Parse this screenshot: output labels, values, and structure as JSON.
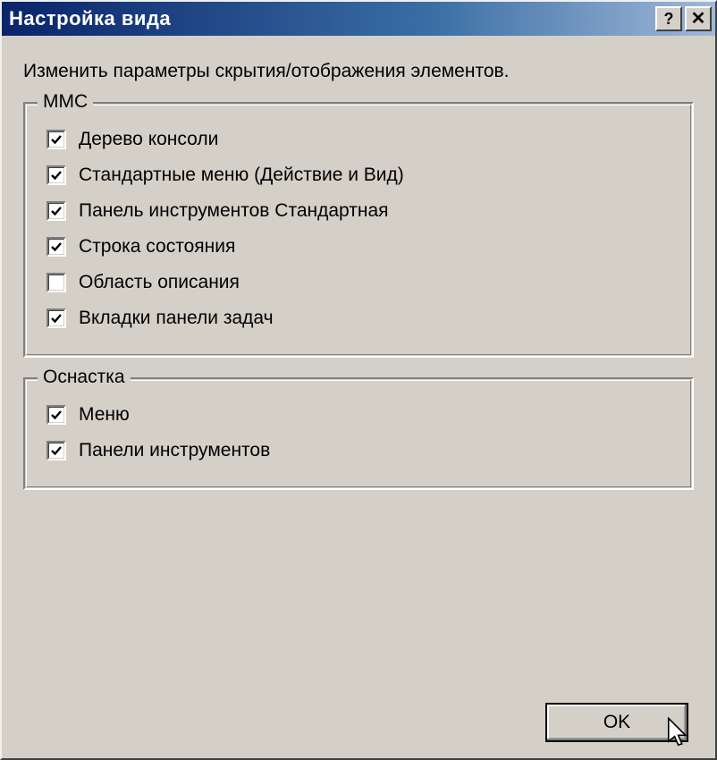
{
  "window": {
    "title": "Настройка вида"
  },
  "instruction": "Изменить параметры скрытия/отображения элементов.",
  "groups": {
    "mmc": {
      "legend": "MMC",
      "items": [
        {
          "label": "Дерево консоли",
          "checked": true
        },
        {
          "label": "Стандартные меню (Действие и Вид)",
          "checked": true
        },
        {
          "label": "Панель инструментов Стандартная",
          "checked": true
        },
        {
          "label": "Строка состояния",
          "checked": true
        },
        {
          "label": "Область описания",
          "checked": false
        },
        {
          "label": "Вкладки панели задач",
          "checked": true
        }
      ]
    },
    "snapin": {
      "legend": "Оснастка",
      "items": [
        {
          "label": "Меню",
          "checked": true
        },
        {
          "label": "Панели инструментов",
          "checked": true
        }
      ]
    }
  },
  "buttons": {
    "ok": "OK",
    "help": "?",
    "close": "✕"
  }
}
